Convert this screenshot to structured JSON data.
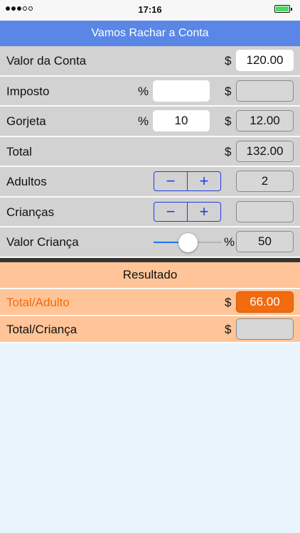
{
  "status_bar": {
    "time": "17:16",
    "signal_dots": [
      true,
      true,
      true,
      false,
      false
    ],
    "battery_color": "#4cd964"
  },
  "nav": {
    "title": "Vamos Rachar a Conta"
  },
  "rows": {
    "valor_conta": {
      "label": "Valor da Conta",
      "currency": "$",
      "value": "120.00"
    },
    "imposto": {
      "label": "Imposto",
      "pct_symbol": "%",
      "pct_value": "",
      "currency": "$",
      "value": ""
    },
    "gorjeta": {
      "label": "Gorjeta",
      "pct_symbol": "%",
      "pct_value": "10",
      "currency": "$",
      "value": "12.00"
    },
    "total": {
      "label": "Total",
      "currency": "$",
      "value": "132.00"
    },
    "adultos": {
      "label": "Adultos",
      "minus": "−",
      "plus": "+",
      "value": "2"
    },
    "criancas": {
      "label": "Crianças",
      "minus": "−",
      "plus": "+",
      "value": ""
    },
    "valor_crianca": {
      "label": "Valor Criança",
      "pct_symbol": "%",
      "value": "50",
      "slider_fraction": 0.5
    }
  },
  "results": {
    "header": "Resultado",
    "total_adulto": {
      "label": "Total/Adulto",
      "currency": "$",
      "value": "66.00"
    },
    "total_crianca": {
      "label": "Total/Criança",
      "currency": "$",
      "value": ""
    }
  },
  "colors": {
    "nav_bg": "#5a87e6",
    "row_bg": "#d2d2d2",
    "result_bg": "#ffc497",
    "accent_orange": "#f26b0f",
    "stepper_blue": "#1d3fe0",
    "slider_blue": "#1f72f0"
  }
}
